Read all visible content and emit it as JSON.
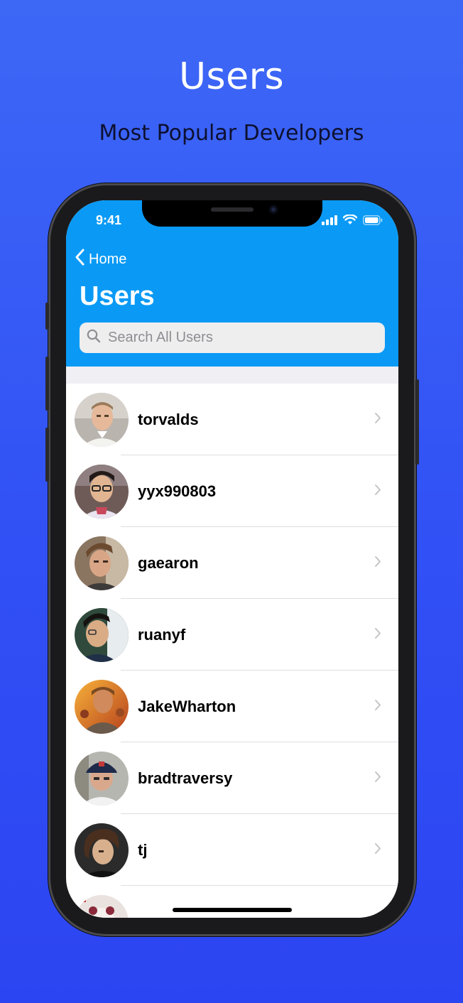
{
  "promo": {
    "title": "Users",
    "subtitle": "Most Popular Developers"
  },
  "status_bar": {
    "time": "9:41",
    "icons": [
      "signal-icon",
      "wifi-icon",
      "battery-icon"
    ]
  },
  "nav": {
    "back_label": "Home",
    "title": "Users",
    "search_placeholder": "Search All Users"
  },
  "colors": {
    "background_top": "#3d68f6",
    "background_bottom": "#2c45f2",
    "nav_bar": "#0a9af6",
    "list_bg": "#ffffff"
  },
  "users": [
    {
      "login": "torvalds",
      "avatar": "avatar-photo"
    },
    {
      "login": "yyx990803",
      "avatar": "avatar-photo"
    },
    {
      "login": "gaearon",
      "avatar": "avatar-photo"
    },
    {
      "login": "ruanyf",
      "avatar": "avatar-photo"
    },
    {
      "login": "JakeWharton",
      "avatar": "avatar-photo"
    },
    {
      "login": "bradtraversy",
      "avatar": "avatar-photo"
    },
    {
      "login": "tj",
      "avatar": "avatar-photo"
    }
  ]
}
